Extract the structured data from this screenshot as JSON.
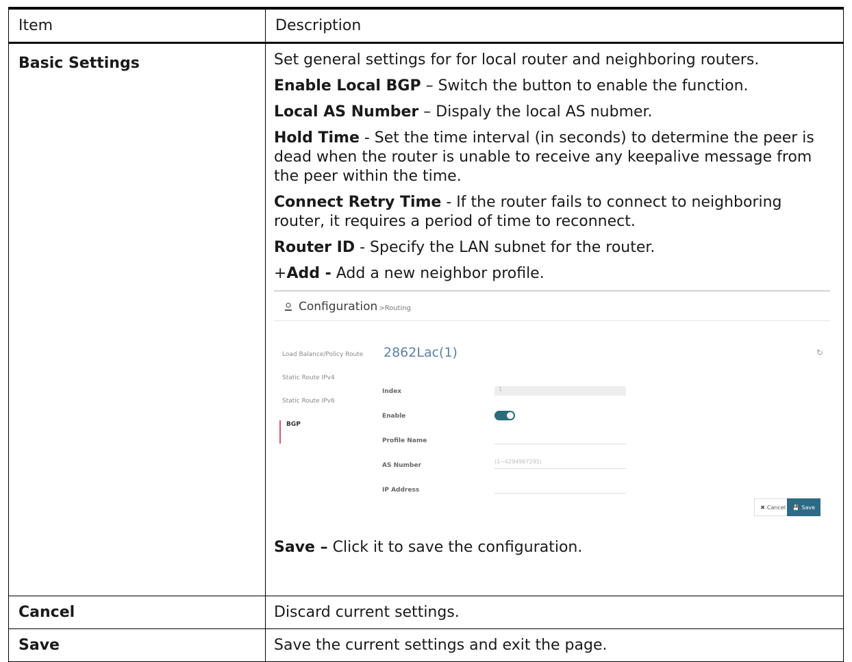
{
  "table": {
    "header": {
      "item": "Item",
      "description": "Description"
    },
    "rows": [
      {
        "item": "Basic Settings",
        "paras": [
          {
            "text": "Set general settings for for local router and neighboring routers."
          },
          {
            "bold": "Enable Local BGP",
            "text": " – Switch the button to enable the function."
          },
          {
            "bold": "Local AS Number",
            "text": " – Dispaly the local AS nubmer."
          },
          {
            "bold": "Hold Time",
            "text": " - Set the time interval (in seconds) to determine the peer is dead when the router is unable to receive any keepalive message from the peer within the time."
          },
          {
            "bold": "Connect Retry Time",
            "text": " - If the router fails to connect to neighboring router, it requires a period of time to reconnect."
          },
          {
            "bold": "Router ID",
            "text": " - Specify the LAN subnet for the router."
          },
          {
            "prefix": "+",
            "bold": "Add -",
            "text": " Add a new neighbor profile."
          }
        ],
        "footer": {
          "bold": "Save –",
          "text": " Click it to save the configuration."
        }
      },
      {
        "item": "Cancel",
        "description": "Discard current settings."
      },
      {
        "item": "Save",
        "description": "Save the current settings and exit the page."
      }
    ]
  },
  "screenshot": {
    "title": "Configuration",
    "breadcrumb": ">Routing",
    "device": "2862Lac(1)",
    "sidebar": [
      "Load Balance/Policy Route",
      "Static Route IPv4",
      "Static Route IPv6",
      "BGP"
    ],
    "fields": {
      "index_label": "Index",
      "index_value": "1",
      "enable_label": "Enable",
      "profile_label": "Profile Name",
      "as_label": "AS Number",
      "as_placeholder": "(1~4294967295)",
      "ip_label": "IP Address"
    },
    "buttons": {
      "cancel": "Cancel",
      "save": "Save"
    }
  }
}
